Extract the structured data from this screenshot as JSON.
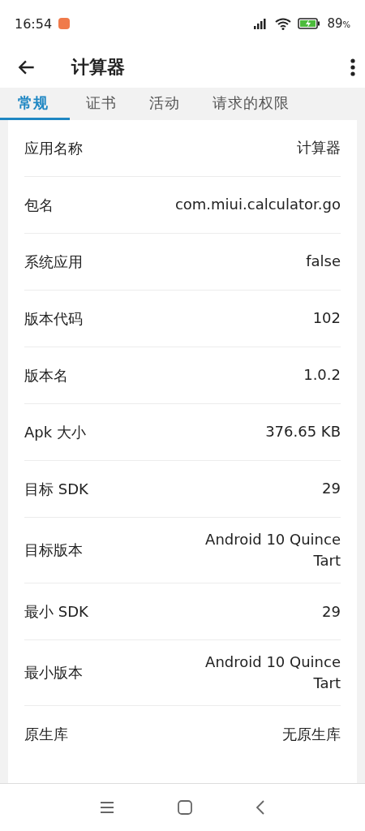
{
  "status_bar": {
    "time": "16:54",
    "battery": "89",
    "battery_unit": "%"
  },
  "app_bar": {
    "title": "计算器"
  },
  "tabs": [
    {
      "label": "常规",
      "selected": true
    },
    {
      "label": "证书",
      "selected": false
    },
    {
      "label": "活动",
      "selected": false
    },
    {
      "label": "请求的权限",
      "selected": false
    }
  ],
  "rows": [
    {
      "label": "应用名称",
      "value": "计算器"
    },
    {
      "label": "包名",
      "value": "com.miui.calculator.go"
    },
    {
      "label": "系统应用",
      "value": "false"
    },
    {
      "label": "版本代码",
      "value": "102"
    },
    {
      "label": "版本名",
      "value": "1.0.2"
    },
    {
      "label": "Apk 大小",
      "value": "376.65 KB"
    },
    {
      "label": "目标 SDK",
      "value": "29"
    },
    {
      "label": "目标版本",
      "value": "Android 10 Quince Tart"
    },
    {
      "label": "最小 SDK",
      "value": "29"
    },
    {
      "label": "最小版本",
      "value": "Android 10 Quince Tart"
    },
    {
      "label": "原生库",
      "value": "无原生库"
    }
  ]
}
